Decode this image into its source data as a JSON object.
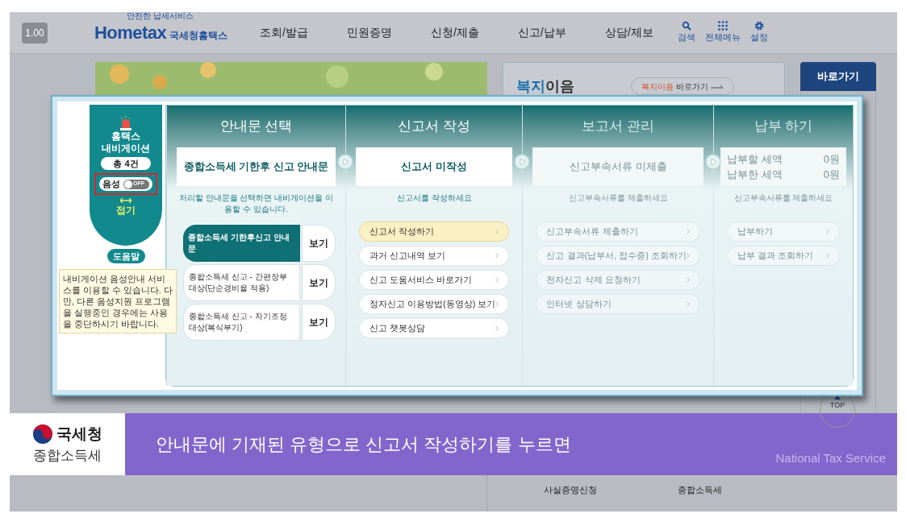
{
  "zoom_badge": "1.00",
  "header": {
    "logo": {
      "tagline": "안전한 납세서비스",
      "brand": "Hometax",
      "name": "국세청홈택스"
    },
    "menu": [
      "조회/발급",
      "민원증명",
      "신청/제출",
      "신고/납부",
      "상담/제보"
    ],
    "tools": [
      {
        "label": "검색"
      },
      {
        "label": "전체메뉴"
      },
      {
        "label": "설정"
      }
    ]
  },
  "welfare": {
    "title_accent": "복지",
    "title_rest": "이음",
    "link_accent": "복지이음",
    "link_rest": "바로가기"
  },
  "shortcut": "바로가기",
  "navigator": {
    "title": [
      "홈택스",
      "내비게이션"
    ],
    "count": "총 4건",
    "voice_label": "음성",
    "voice_on": false,
    "switch_text": "OFF",
    "highlighted": true,
    "collapse": "접기",
    "help": "도움말",
    "tooltip": "내비게이션 음성안내 서비스를 이용할 수 있습니다. 다만, 다른 음성지원 프로그램을 실행중인 경우에는 사용을 중단하시기 바랍니다."
  },
  "columns": [
    {
      "title": "안내문 선택",
      "disabled": false,
      "status": "종합소득세 기한후 신고 안내문",
      "hint": "처리할 안내문을 선택하면 내비게이션을 이용할 수 있습니다.",
      "notices": [
        {
          "label": "종합소득세 기한후신고 안내문",
          "button": "보기",
          "selected": true
        },
        {
          "label": "종합소득세 신고 - 간편장부 대상(단순경비율 적용)",
          "button": "보기",
          "selected": false
        },
        {
          "label": "종합소득세 신고 - 자기조정 대상(복식부기)",
          "button": "보기",
          "selected": false
        }
      ]
    },
    {
      "title": "신고서 작성",
      "disabled": false,
      "status": "신고서 미작성",
      "hint": "신고서를 작성하세요",
      "links": [
        {
          "label": "신고서 작성하기",
          "selected": true
        },
        {
          "label": "과거 신고내역 보기",
          "selected": false
        },
        {
          "label": "신고 도움서비스 바로가기",
          "selected": false
        },
        {
          "label": "정자신고 이용방법(동영상) 보기",
          "selected": false
        },
        {
          "label": "신고 챗봇상담",
          "selected": false
        }
      ]
    },
    {
      "title": "보고서 관리",
      "disabled": true,
      "status": "신고부속서류 미제출",
      "hint": "신고부속서류를 제출하세요",
      "links": [
        {
          "label": "신고부속서류 제출하기",
          "selected": false
        },
        {
          "label": "신고 결과(납부서, 접수증) 조회하기",
          "selected": false
        },
        {
          "label": "전자신고 삭제 요청하기",
          "selected": false
        },
        {
          "label": "인터넷 상담하기",
          "selected": false
        }
      ]
    },
    {
      "title": "납부 하기",
      "disabled": true,
      "amounts": [
        {
          "label": "납부할 세액",
          "value": "0원"
        },
        {
          "label": "납부한 세액",
          "value": "0원"
        }
      ],
      "hint": "신고부속서류를 제출하세요",
      "links": [
        {
          "label": "납부하기",
          "selected": false
        },
        {
          "label": "납부 결과 조회하기",
          "selected": false
        }
      ]
    }
  ],
  "caption": {
    "org": "국세청",
    "subject": "종합소득세",
    "text": "안내문에 기재된 유형으로 신고서 작성하기를 누르면",
    "brand": "National Tax Service"
  },
  "footer": [
    "사실증명신청",
    "종합소득세"
  ],
  "top_button": "TOP"
}
